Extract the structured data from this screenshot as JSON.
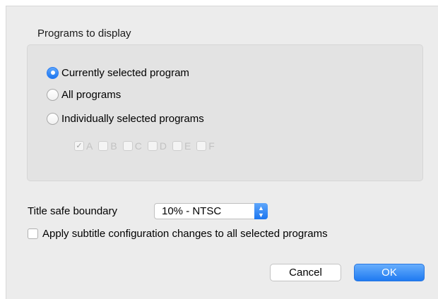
{
  "group": {
    "title": "Programs to display",
    "options": [
      {
        "label": "Currently selected program",
        "selected": true
      },
      {
        "label": "All programs",
        "selected": false
      },
      {
        "label": "Individually selected programs",
        "selected": false
      }
    ],
    "programs": [
      {
        "label": "A",
        "checked": true
      },
      {
        "label": "B",
        "checked": false
      },
      {
        "label": "C",
        "checked": false
      },
      {
        "label": "D",
        "checked": false
      },
      {
        "label": "E",
        "checked": false
      },
      {
        "label": "F",
        "checked": false
      }
    ]
  },
  "title_safe": {
    "label": "Title safe boundary",
    "value": "10% - NTSC"
  },
  "apply_subtitles": {
    "label": "Apply subtitle configuration changes to all selected programs",
    "checked": false
  },
  "buttons": {
    "cancel": "Cancel",
    "ok": "OK"
  },
  "colors": {
    "accent": "#1c76f0",
    "panel": "#ececec",
    "groupbox": "#e3e3e3"
  },
  "icons": {
    "select_arrows": "up-down-chevron-icon",
    "check": "checkmark-icon"
  }
}
